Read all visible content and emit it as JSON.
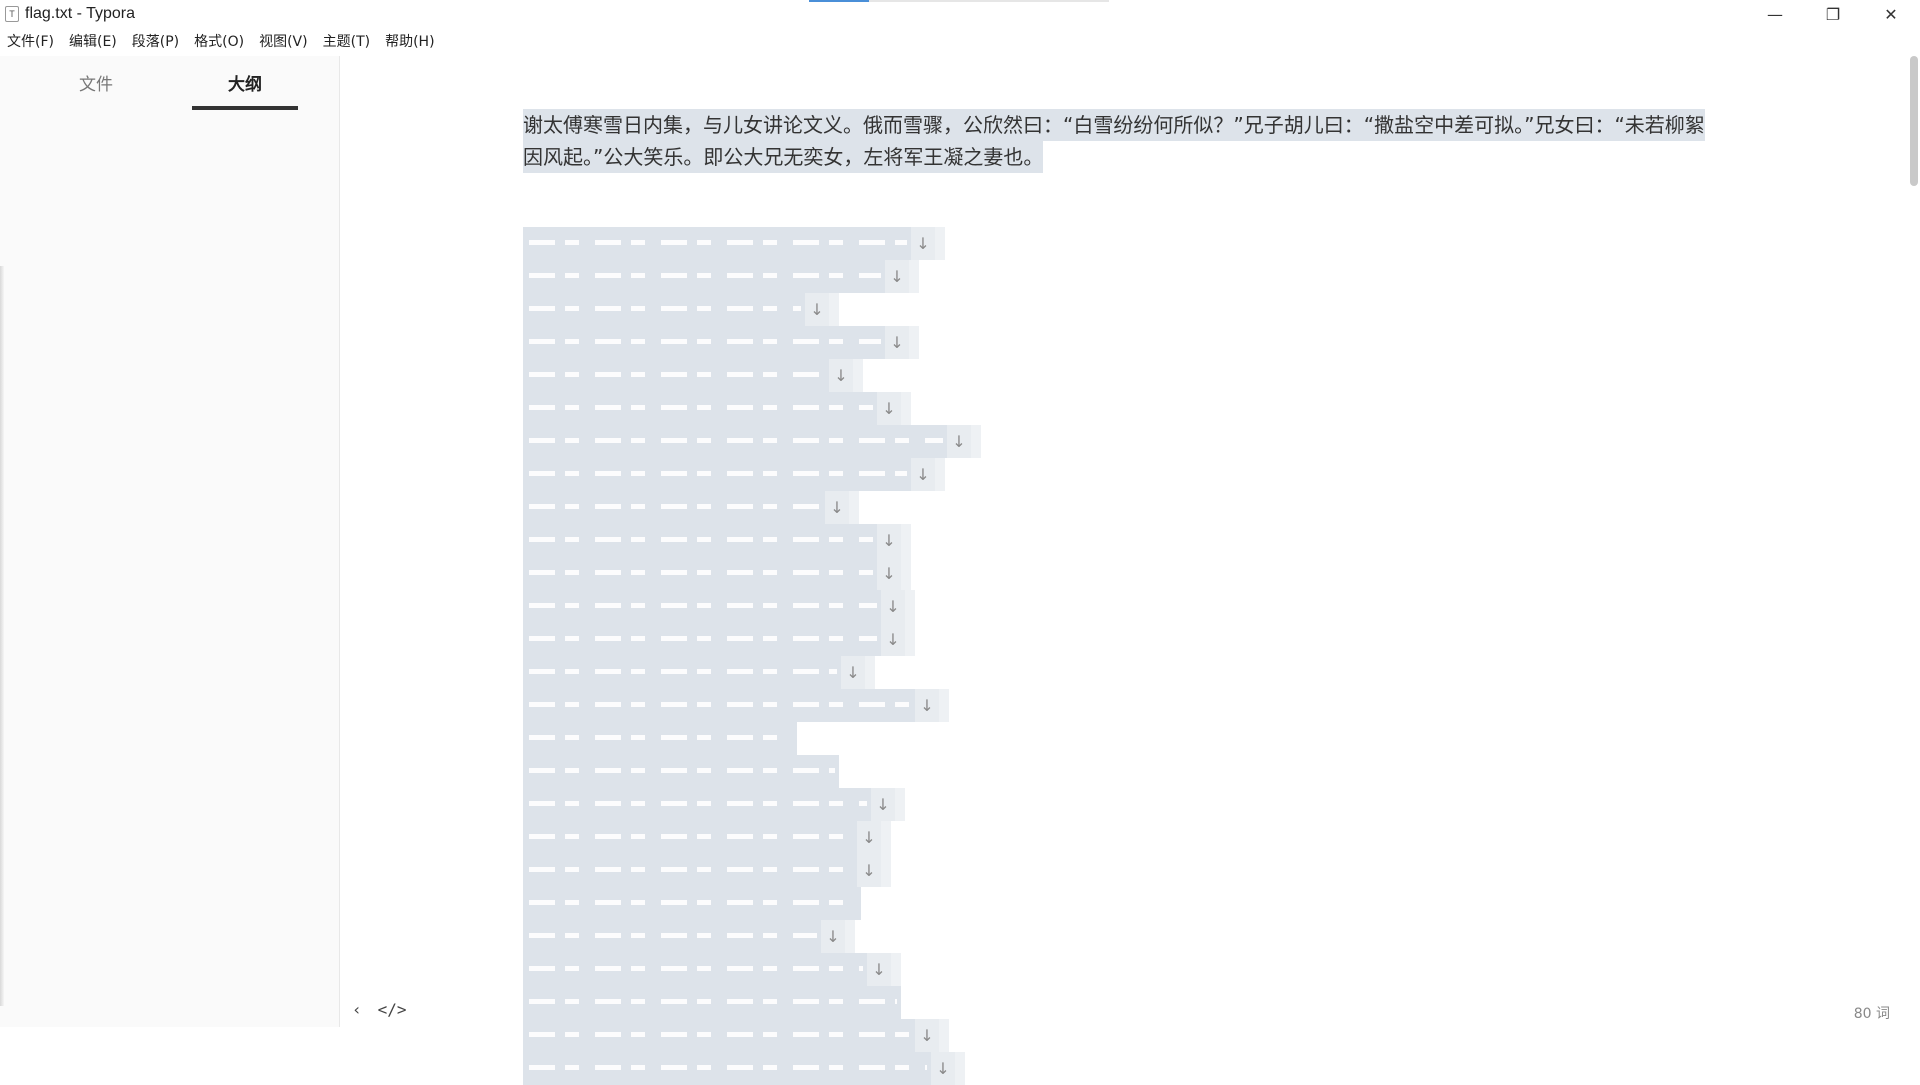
{
  "window": {
    "title": "flag.txt - Typora",
    "app_icon_glyph": "T",
    "controls": {
      "minimize": "—",
      "maximize": "❐",
      "close": "✕"
    }
  },
  "menu": [
    "文件(F)",
    "编辑(E)",
    "段落(P)",
    "格式(O)",
    "视图(V)",
    "主题(T)",
    "帮助(H)"
  ],
  "sidebar": {
    "tabs": [
      {
        "label": "文件",
        "active": false
      },
      {
        "label": "大纲",
        "active": true
      }
    ]
  },
  "editor": {
    "paragraph_lines": [
      "谢太傅寒雪日内集，与儿女讲论文义。俄而雪骤，公欣然曰：“白雪纷纷何所似？”兄子胡儿曰：“撒盐空中差可拟。”兄女曰：“未若柳絮",
      "因风起。”公大笑乐。即公大兄无奕女，左将军王凝之妻也。"
    ],
    "newline_marker": "↓"
  },
  "footer": {
    "back_glyph": "‹",
    "source_glyph": "</>",
    "word_count": "80 词"
  },
  "colors": {
    "selection": "#dde3ea",
    "sidebar_bg": "#fafafa",
    "accent": "#4a8fd8"
  }
}
